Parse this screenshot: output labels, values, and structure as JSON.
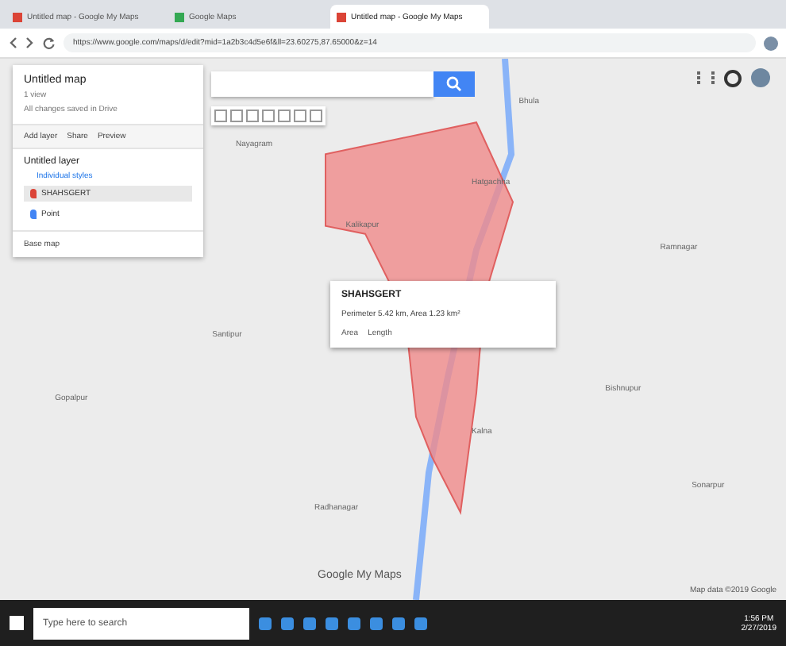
{
  "tabs": [
    {
      "title": "Untitled map - Google My Maps",
      "selected": false,
      "color": "#db4437"
    },
    {
      "title": "Google Maps",
      "selected": false,
      "color": "#34a853"
    },
    {
      "title": "Untitled map - Google My Maps",
      "selected": true,
      "color": "#db4437"
    }
  ],
  "address_bar": {
    "url": "https://www.google.com/maps/d/edit?mid=1a2b3c4d5e6f&ll=23.60275,87.65000&z=14"
  },
  "map_panel": {
    "title": "Untitled map",
    "subtitle": "1 view",
    "status": "All changes saved in Drive",
    "actions": [
      "Add layer",
      "Share",
      "Preview"
    ],
    "layer": {
      "name": "Untitled layer",
      "style": "Individual styles",
      "items": [
        {
          "label": "SHAHSGERT",
          "selected": true,
          "color": "#db4437"
        },
        {
          "label": "Point",
          "selected": false,
          "color": "#4285f4"
        }
      ]
    },
    "base_map": "Base map"
  },
  "popup": {
    "title": "SHAHSGERT",
    "description": "Perimeter 5.42 km, Area 1.23 km²",
    "footer": [
      "Area",
      "Length"
    ]
  },
  "place_labels": [
    "Nayagram",
    "Bhula",
    "Kalikapur",
    "Hatgachha",
    "Santipur",
    "Ramnagar",
    "Gopalpur",
    "Kalna",
    "Bishnupur",
    "Radhanagar",
    "Sonarpur"
  ],
  "logo": "Google My Maps",
  "attribution": "Map data ©2019 Google",
  "taskbar": {
    "search_placeholder": "Type here to search",
    "time": "1:56 PM",
    "date": "2/27/2019"
  }
}
